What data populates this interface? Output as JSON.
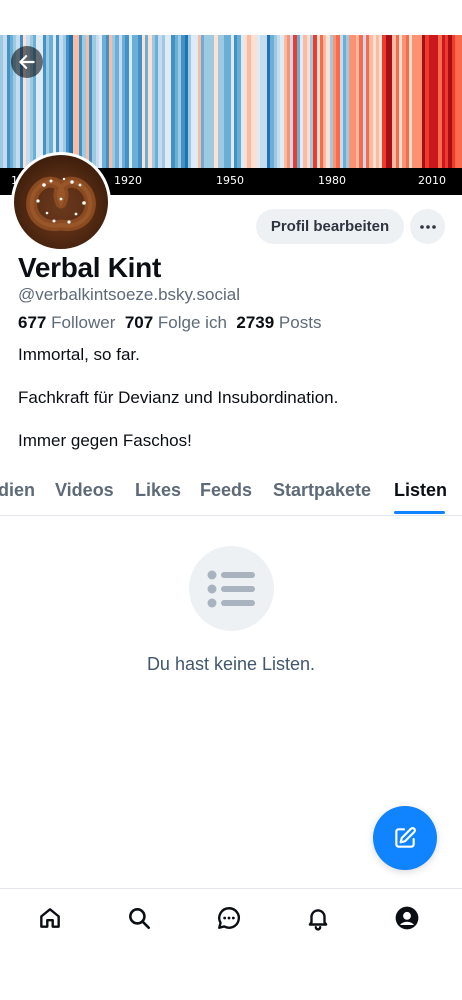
{
  "banner": {
    "year_labels": [
      "1920",
      "1950",
      "1980",
      "2010"
    ],
    "partial_label": "1"
  },
  "profile": {
    "display_name": "Verbal Kint",
    "handle": "@verbalkintsoeze.bsky.social",
    "followers_count": "677",
    "followers_label": "Follower",
    "following_count": "707",
    "following_label": "Folge ich",
    "posts_count": "2739",
    "posts_label": "Posts",
    "bio": [
      "Immortal, so far.",
      "Fachkraft für Devianz und Insubordination.",
      "Immer gegen Faschos!"
    ]
  },
  "actions": {
    "edit_profile": "Profil bearbeiten",
    "more_label": "···"
  },
  "tabs": [
    {
      "label": "dien",
      "active": false
    },
    {
      "label": "Videos",
      "active": false
    },
    {
      "label": "Likes",
      "active": false
    },
    {
      "label": "Feeds",
      "active": false
    },
    {
      "label": "Startpakete",
      "active": false
    },
    {
      "label": "Listen",
      "active": true
    }
  ],
  "empty_state": {
    "icon": "list-icon",
    "message": "Du hast keine Listen."
  },
  "fab": {
    "icon": "compose-icon"
  },
  "bottom_nav": [
    "home-icon",
    "search-icon",
    "chat-icon",
    "bell-icon",
    "profile-icon"
  ],
  "colors": {
    "accent": "#1083fe",
    "muted_text": "#5e6a78",
    "button_bg": "#eef1f4",
    "empty_text": "#42576c"
  }
}
